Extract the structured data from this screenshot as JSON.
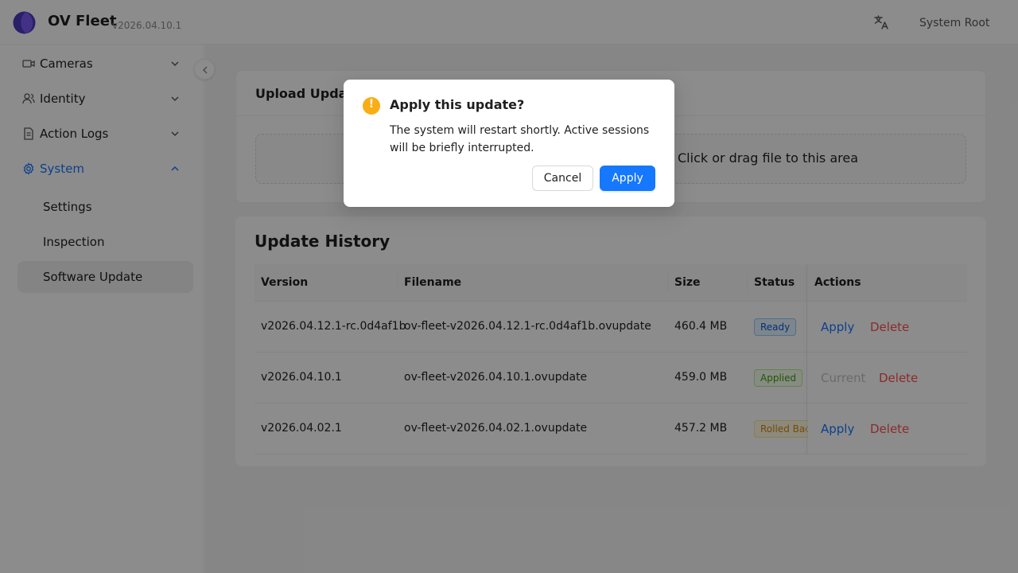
{
  "app": {
    "name": "OV Fleet",
    "version": "v2026.04.10.1"
  },
  "header": {
    "user": "System Root",
    "language_icon": "translate-icon"
  },
  "sidebar": {
    "items": [
      {
        "label": "Cameras",
        "icon": "camera-icon",
        "expanded": false
      },
      {
        "label": "Identity",
        "icon": "users-icon",
        "expanded": false
      },
      {
        "label": "Action Logs",
        "icon": "file-icon",
        "expanded": false
      },
      {
        "label": "System",
        "icon": "gear-icon",
        "expanded": true
      }
    ],
    "sub_items": [
      {
        "label": "Settings"
      },
      {
        "label": "Inspection"
      },
      {
        "label": "Software Update",
        "selected": true
      }
    ]
  },
  "upload": {
    "title": "Upload Update",
    "dropzone_text": "Click or drag file to this area"
  },
  "history": {
    "title": "Update History",
    "columns": [
      "Version",
      "Filename",
      "Size",
      "Status",
      "Actions"
    ],
    "rows": [
      {
        "version": "v2026.04.12.1-rc.0d4af1b",
        "filename": "ov-fleet-v2026.04.12.1-rc.0d4af1b.ovupdate",
        "size": "460.4 MB",
        "status": "Ready",
        "action1": "Apply",
        "action2": "Delete"
      },
      {
        "version": "v2026.04.10.1",
        "filename": "ov-fleet-v2026.04.10.1.ovupdate",
        "size": "459.0 MB",
        "status": "Applied",
        "action1": "Current",
        "action2": "Delete"
      },
      {
        "version": "v2026.04.02.1",
        "filename": "ov-fleet-v2026.04.02.1.ovupdate",
        "size": "457.2 MB",
        "status": "Rolled Back",
        "action1": "Apply",
        "action2": "Delete"
      }
    ]
  },
  "modal": {
    "title": "Apply this update?",
    "body": "The system will restart shortly. Active sessions will be briefly interrupted.",
    "cancel_label": "Cancel",
    "confirm_label": "Apply",
    "icon": "warning-icon"
  },
  "colors": {
    "primary": "#1677ff",
    "danger": "#ff4d4f",
    "warning": "#faad14"
  }
}
